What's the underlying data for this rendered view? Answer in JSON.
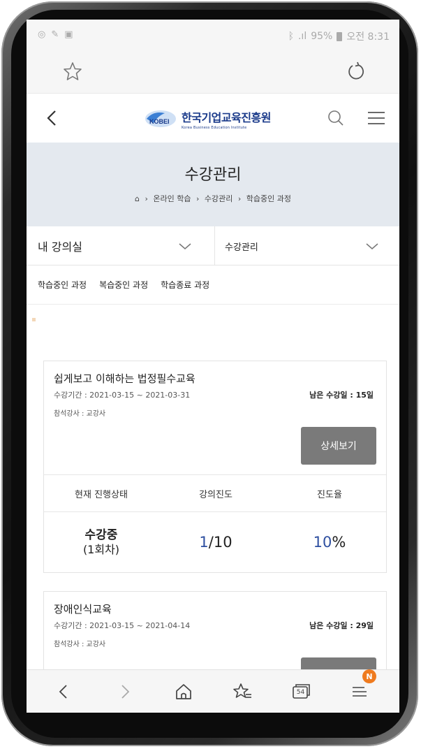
{
  "status_bar": {
    "battery": "95%",
    "time": "오전 8:31"
  },
  "site": {
    "logo_name": "한국기업교육진흥원",
    "logo_mark": "KOBEI",
    "logo_sub": "Korea Business Education Institute"
  },
  "page": {
    "title": "수강관리",
    "breadcrumb": [
      "온라인 학습",
      "수강관리",
      "학습중인 과정"
    ]
  },
  "dropdowns": {
    "left": "내 강의실",
    "right": "수강관리"
  },
  "tabs": [
    "학습중인 과정",
    "복습중인 과정",
    "학습종료 과정"
  ],
  "courses": [
    {
      "title": "쉽게보고 이해하는 법정필수교육",
      "period": "수강기간 : 2021-03-15 ~ 2021-03-31",
      "remaining": "남은 수강일 : 15일",
      "teacher": "참석강사 : 교강사",
      "detail_label": "상세보기",
      "stats_headers": [
        "현재 진행상태",
        "강의진도",
        "진도율"
      ],
      "status_main": "수강중",
      "status_sub": "(1회차)",
      "progress_done": "1",
      "progress_total": "/10",
      "rate_value": "10",
      "rate_unit": "%"
    },
    {
      "title": "장애인식교육",
      "period": "수강기간 : 2021-03-15 ~ 2021-04-14",
      "remaining": "남은 수강일 : 29일",
      "teacher": "참석강사 : 교강사"
    }
  ],
  "bottom_nav": {
    "tabs_count": "54",
    "notif_badge": "N"
  },
  "colors": {
    "accent_blue": "#2e4fa0",
    "title_band": "#e4e9ef",
    "detail_button": "#7a7a7a",
    "badge": "#ef7b1f"
  },
  "icons": [
    "bookmark-star-icon",
    "reload-icon",
    "back-arrow-icon",
    "search-icon",
    "hamburger-menu-icon",
    "home-icon",
    "chevron-down-icon",
    "forward-arrow-icon",
    "bookmarks-icon",
    "tabs-icon",
    "menu-icon"
  ]
}
